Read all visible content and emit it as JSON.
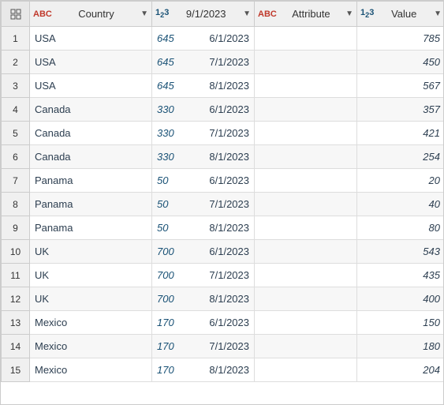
{
  "columns": [
    {
      "id": "row-num",
      "label": "",
      "type": "rownum"
    },
    {
      "id": "country",
      "label": "Country",
      "type": "abc"
    },
    {
      "id": "date",
      "label": "9/1/2023",
      "type": "123"
    },
    {
      "id": "attribute",
      "label": "Attribute",
      "type": "abc"
    },
    {
      "id": "value",
      "label": "Value",
      "type": "123"
    }
  ],
  "rows": [
    {
      "num": 1,
      "country": "USA",
      "date": "6/1/2023",
      "date_num": 645,
      "attribute": "",
      "value": 785
    },
    {
      "num": 2,
      "country": "USA",
      "date": "7/1/2023",
      "date_num": 645,
      "attribute": "",
      "value": 450
    },
    {
      "num": 3,
      "country": "USA",
      "date": "8/1/2023",
      "date_num": 645,
      "attribute": "",
      "value": 567
    },
    {
      "num": 4,
      "country": "Canada",
      "date": "6/1/2023",
      "date_num": 330,
      "attribute": "",
      "value": 357
    },
    {
      "num": 5,
      "country": "Canada",
      "date": "7/1/2023",
      "date_num": 330,
      "attribute": "",
      "value": 421
    },
    {
      "num": 6,
      "country": "Canada",
      "date": "8/1/2023",
      "date_num": 330,
      "attribute": "",
      "value": 254
    },
    {
      "num": 7,
      "country": "Panama",
      "date": "6/1/2023",
      "date_num": 50,
      "attribute": "",
      "value": 20
    },
    {
      "num": 8,
      "country": "Panama",
      "date": "7/1/2023",
      "date_num": 50,
      "attribute": "",
      "value": 40
    },
    {
      "num": 9,
      "country": "Panama",
      "date": "8/1/2023",
      "date_num": 50,
      "attribute": "",
      "value": 80
    },
    {
      "num": 10,
      "country": "UK",
      "date": "6/1/2023",
      "date_num": 700,
      "attribute": "",
      "value": 543
    },
    {
      "num": 11,
      "country": "UK",
      "date": "7/1/2023",
      "date_num": 700,
      "attribute": "",
      "value": 435
    },
    {
      "num": 12,
      "country": "UK",
      "date": "8/1/2023",
      "date_num": 700,
      "attribute": "",
      "value": 400
    },
    {
      "num": 13,
      "country": "Mexico",
      "date": "6/1/2023",
      "date_num": 170,
      "attribute": "",
      "value": 150
    },
    {
      "num": 14,
      "country": "Mexico",
      "date": "7/1/2023",
      "date_num": 170,
      "attribute": "",
      "value": 180
    },
    {
      "num": 15,
      "country": "Mexico",
      "date": "8/1/2023",
      "date_num": 170,
      "attribute": "",
      "value": 204
    }
  ]
}
